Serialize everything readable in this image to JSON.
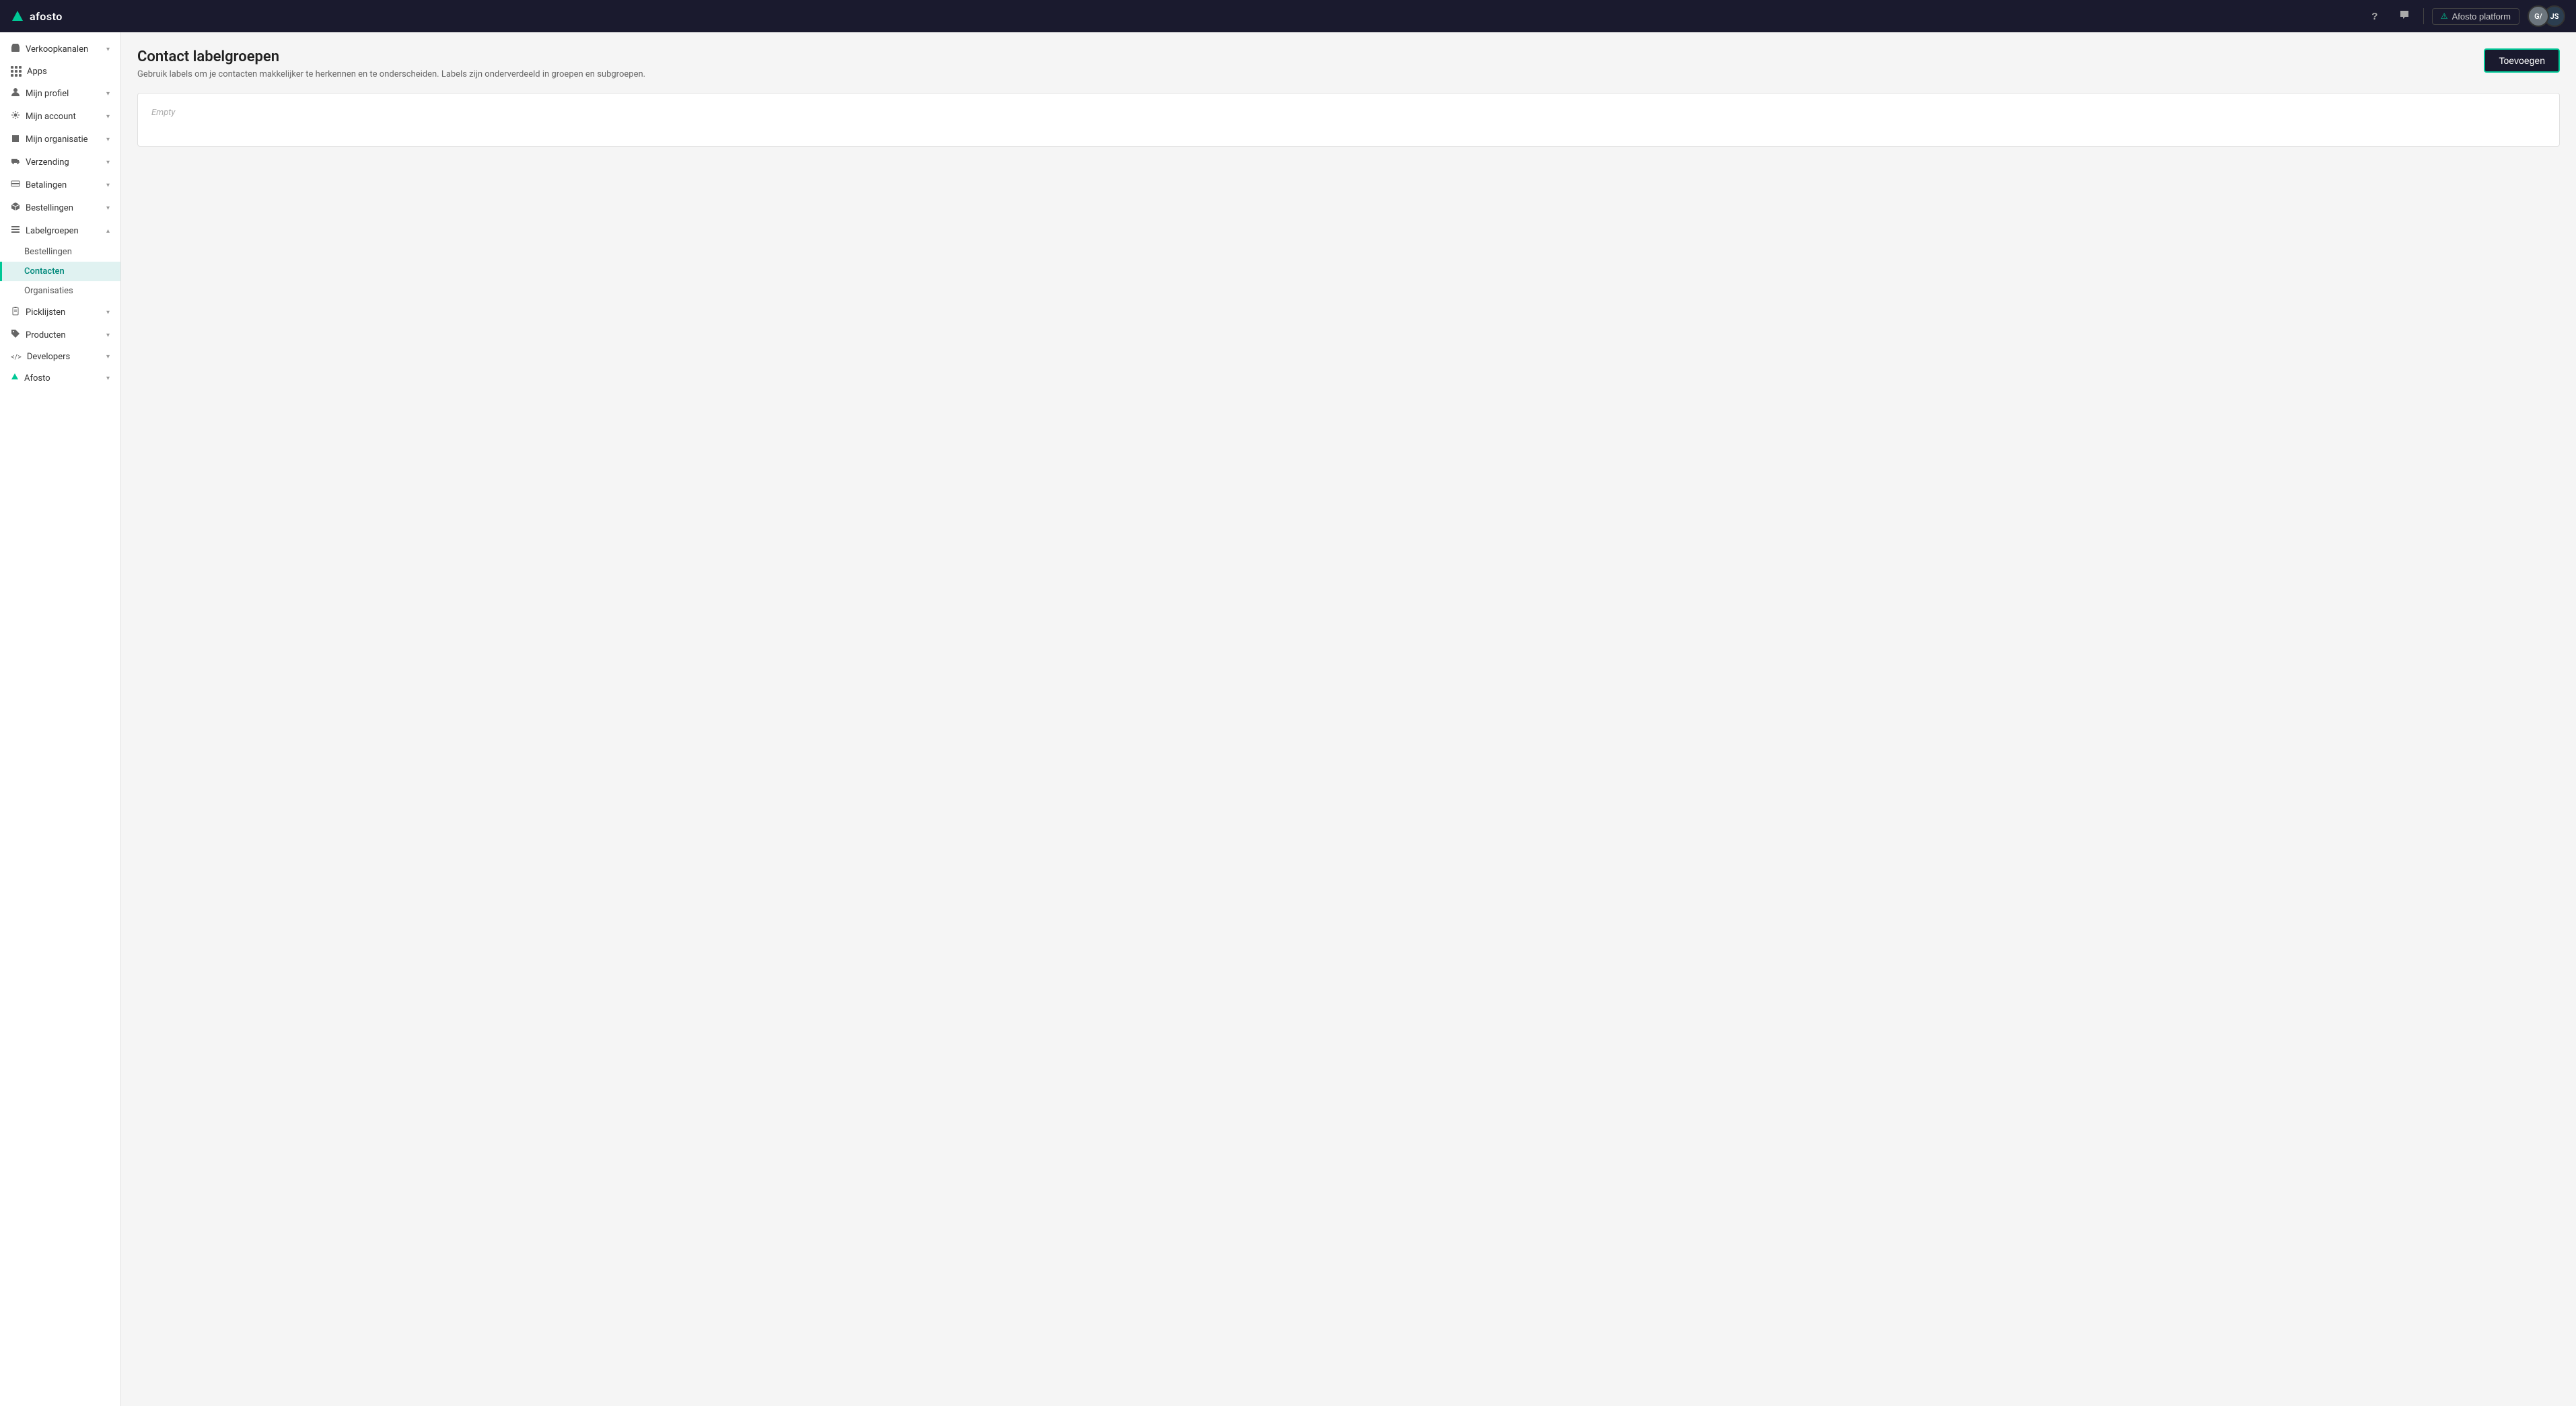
{
  "topnav": {
    "logo_text": "afosto",
    "help_label": "?",
    "chat_label": "chat",
    "platform_btn": "Afosto platform",
    "avatar_g": "G/",
    "avatar_j": "JS"
  },
  "sidebar": {
    "items": [
      {
        "id": "verkoopkanalen",
        "label": "Verkoopkanalen",
        "icon": "store",
        "hasChevron": true,
        "expanded": false
      },
      {
        "id": "apps",
        "label": "Apps",
        "icon": "grid",
        "hasChevron": false,
        "expanded": false
      },
      {
        "id": "mijn-profiel",
        "label": "Mijn profiel",
        "icon": "person",
        "hasChevron": true,
        "expanded": false
      },
      {
        "id": "mijn-account",
        "label": "Mijn account",
        "icon": "gear",
        "hasChevron": true,
        "expanded": false
      },
      {
        "id": "mijn-organisatie",
        "label": "Mijn organisatie",
        "icon": "building",
        "hasChevron": true,
        "expanded": false
      },
      {
        "id": "verzending",
        "label": "Verzending",
        "icon": "truck",
        "hasChevron": true,
        "expanded": false
      },
      {
        "id": "betalingen",
        "label": "Betalingen",
        "icon": "card",
        "hasChevron": true,
        "expanded": false
      },
      {
        "id": "bestellingen",
        "label": "Bestellingen",
        "icon": "box",
        "hasChevron": true,
        "expanded": false
      },
      {
        "id": "labelgroepen",
        "label": "Labelgroepen",
        "icon": "list",
        "hasChevron": true,
        "expanded": true
      },
      {
        "id": "picklijsten",
        "label": "Picklijsten",
        "icon": "clipboard",
        "hasChevron": true,
        "expanded": false
      },
      {
        "id": "producten",
        "label": "Producten",
        "icon": "tag",
        "hasChevron": true,
        "expanded": false
      },
      {
        "id": "developers",
        "label": "Developers",
        "icon": "code",
        "hasChevron": true,
        "expanded": false
      },
      {
        "id": "afosto",
        "label": "Afosto",
        "icon": "triangle",
        "hasChevron": true,
        "expanded": false
      }
    ],
    "subitems_labelgroepen": [
      {
        "id": "bestellingen-sub",
        "label": "Bestellingen",
        "active": false
      },
      {
        "id": "contacten",
        "label": "Contacten",
        "active": true
      },
      {
        "id": "organisaties",
        "label": "Organisaties",
        "active": false
      }
    ]
  },
  "page": {
    "title": "Contact labelgroepen",
    "subtitle": "Gebruik labels om je contacten makkelijker te herkennen en te onderscheiden. Labels zijn onderverdeeld in groepen en subgroepen.",
    "add_button_label": "Toevoegen",
    "empty_text": "Empty"
  }
}
